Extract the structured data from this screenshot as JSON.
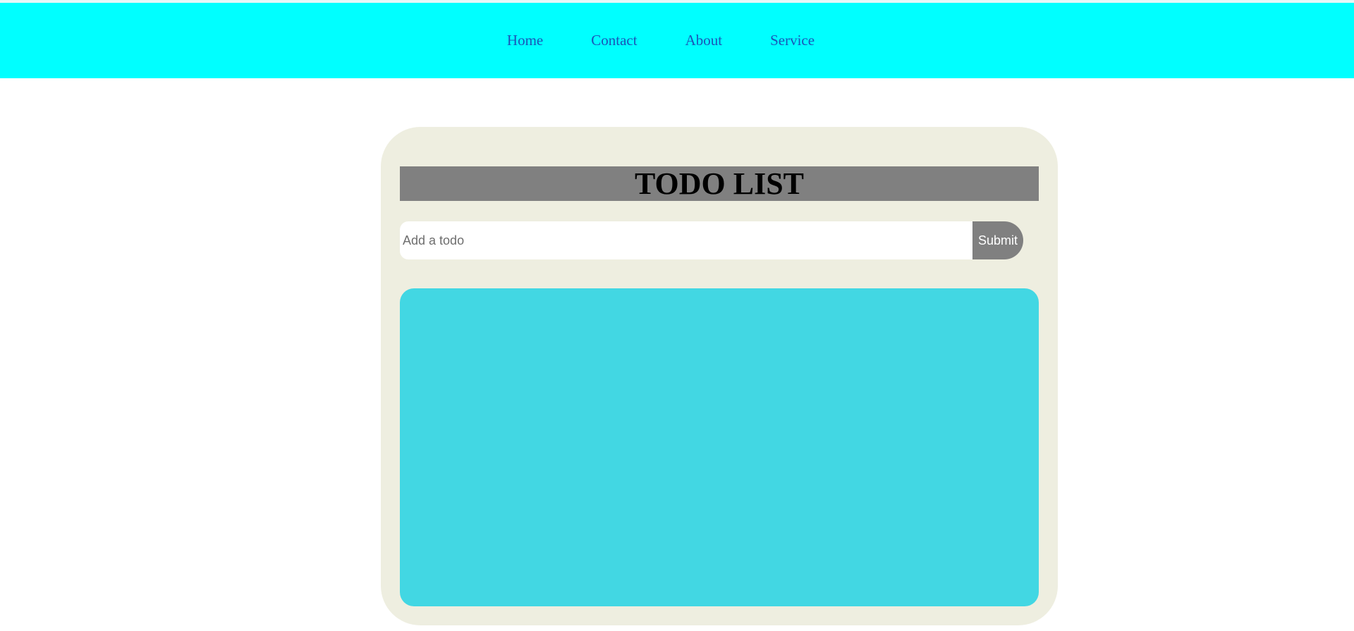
{
  "nav": {
    "items": [
      {
        "label": "Home"
      },
      {
        "label": "Contact"
      },
      {
        "label": "About"
      },
      {
        "label": "Service"
      }
    ]
  },
  "todo": {
    "title": "TODO LIST",
    "input": {
      "value": "",
      "placeholder": "Add a todo"
    },
    "submit_label": "Submit",
    "items": []
  },
  "colors": {
    "navbar": "#00ffff",
    "nav_link": "#1a55b8",
    "card": "#eeeee0",
    "title_bar": "#808080",
    "submit_button": "#808080",
    "list_area": "#42d7e3"
  }
}
